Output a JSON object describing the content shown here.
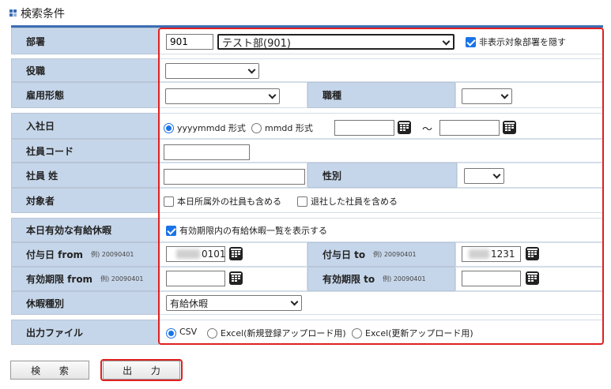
{
  "section_title": "検索条件",
  "dept": {
    "label": "部署",
    "code": "901",
    "selected": "テスト部(901)",
    "hide_checkbox_label": "非表示対象部署を隠す",
    "hide_checked": true
  },
  "position": {
    "label": "役職",
    "selected": ""
  },
  "employment_type": {
    "label": "雇用形態",
    "selected": ""
  },
  "job_type": {
    "label": "職種",
    "selected": ""
  },
  "hire_date": {
    "label": "入社日",
    "format_yyyymmdd": "yyyymmdd 形式",
    "format_mmdd": "mmdd 形式",
    "selected_format": "yyyymmdd",
    "from": "",
    "tilde": "～",
    "to": ""
  },
  "employee_code": {
    "label": "社員コード",
    "value": ""
  },
  "employee_surname": {
    "label": "社員 姓",
    "value": ""
  },
  "gender": {
    "label": "性別",
    "selected": ""
  },
  "target": {
    "label": "対象者",
    "include_other_dept": "本日所属外の社員も含める",
    "include_retired": "退社した社員を含める"
  },
  "valid_leave": {
    "label": "本日有効な有給休暇",
    "checkbox_label": "有効期限内の有給休暇一覧を表示する",
    "checked": true
  },
  "grant_from": {
    "label": "付与日 from",
    "example": "例) 20090401",
    "value_visible": "0101"
  },
  "grant_to": {
    "label": "付与日 to",
    "example": "例) 20090401",
    "value_visible": "1231"
  },
  "expire_from": {
    "label": "有効期限 from",
    "example": "例) 20090401",
    "value": ""
  },
  "expire_to": {
    "label": "有効期限 to",
    "example": "例) 20090401",
    "value": ""
  },
  "leave_type": {
    "label": "休暇種別",
    "selected": "有給休暇"
  },
  "output_file": {
    "label": "出力ファイル",
    "options": [
      "CSV",
      "Excel(新規登録アップロード用)",
      "Excel(更新アップロード用)"
    ],
    "selected": "CSV"
  },
  "buttons": {
    "search": "検 索",
    "output": "出 力"
  },
  "colors": {
    "accent": "#3b6db5",
    "label_bg": "#c6d6ea",
    "highlight": "#e02020",
    "radio_checked": "#1a73e8"
  }
}
